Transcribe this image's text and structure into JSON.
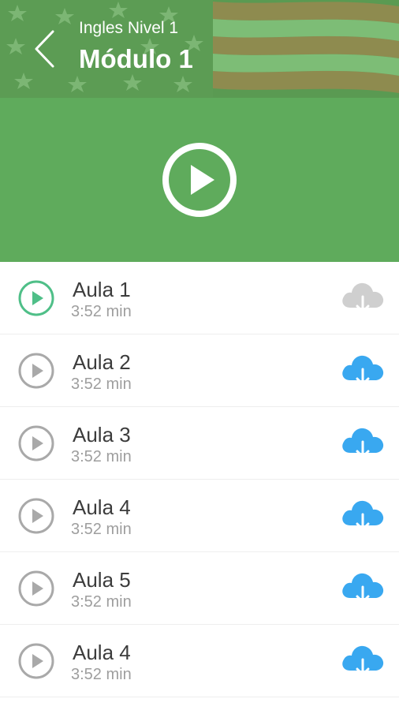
{
  "header": {
    "subtitle": "Ingles Nivel 1",
    "title": "Módulo 1"
  },
  "colors": {
    "header_green": "#5e9f57",
    "player_green": "#5fab5c",
    "active_play": "#4fbf88",
    "inactive_play": "#a9a9a9",
    "download_available": "#39a8f0",
    "download_disabled": "#cfcfcf"
  },
  "player": {
    "icon": "play-circle-icon"
  },
  "lessons": [
    {
      "title": "Aula 1",
      "duration": "3:52 min",
      "state": "active",
      "download": "disabled"
    },
    {
      "title": "Aula 2",
      "duration": "3:52 min",
      "state": "idle",
      "download": "available"
    },
    {
      "title": "Aula 3",
      "duration": "3:52 min",
      "state": "idle",
      "download": "available"
    },
    {
      "title": "Aula 4",
      "duration": "3:52 min",
      "state": "idle",
      "download": "available"
    },
    {
      "title": "Aula 5",
      "duration": "3:52 min",
      "state": "idle",
      "download": "available"
    },
    {
      "title": "Aula 4",
      "duration": "3:52 min",
      "state": "idle",
      "download": "available"
    }
  ]
}
